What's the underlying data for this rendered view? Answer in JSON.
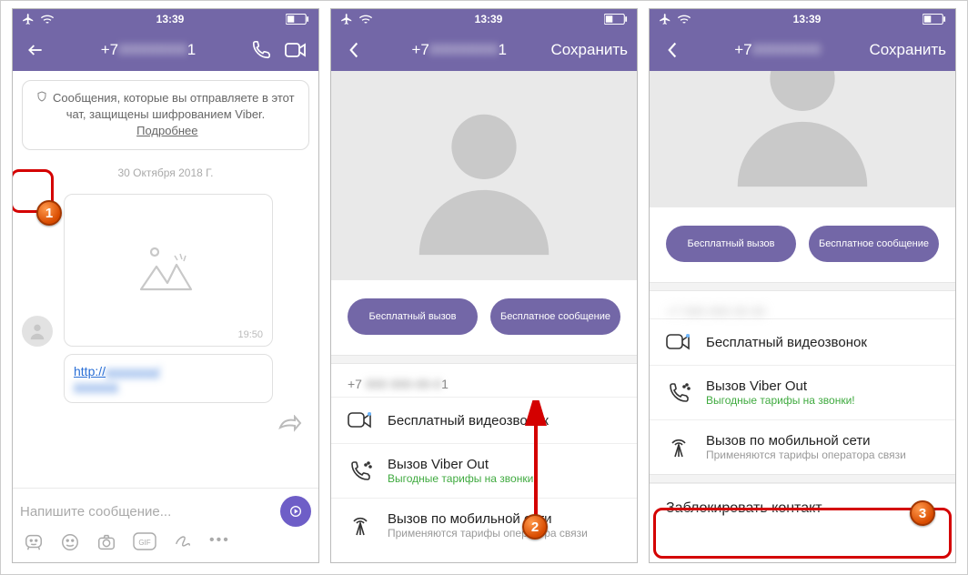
{
  "status": {
    "time": "13:39"
  },
  "screen1": {
    "title_prefix": "+7",
    "title_suffix": "1",
    "encryption_notice": "Сообщения, которые вы отправляете в этот чат, защищены шифрованием Viber.",
    "encryption_more": "Подробнее",
    "date": "30 Октября 2018 Г.",
    "msg_time": "19:50",
    "link_prefix": "http://",
    "compose_placeholder": "Напишите сообщение..."
  },
  "screen2": {
    "title_prefix": "+7",
    "title_suffix": "1",
    "save": "Сохранить",
    "cta_call": "Бесплатный вызов",
    "cta_msg": "Бесплатное сообщение",
    "phone_prefix": "+7",
    "phone_suffix": "1",
    "opt_video": "Бесплатный видеозвонок",
    "opt_viberout": "Вызов Viber Out",
    "opt_viberout_sub": "Выгодные тарифы на звонки!",
    "opt_mobile": "Вызов по мобильной сети",
    "opt_mobile_sub": "Применяются тарифы оператора связи"
  },
  "screen3": {
    "title_prefix": "+7",
    "save": "Сохранить",
    "cta_call": "Бесплатный вызов",
    "cta_msg": "Бесплатное сообщение",
    "opt_video": "Бесплатный видеозвонок",
    "opt_viberout": "Вызов Viber Out",
    "opt_viberout_sub": "Выгодные тарифы на звонки!",
    "opt_mobile": "Вызов по мобильной сети",
    "opt_mobile_sub": "Применяются тарифы оператора связи",
    "block": "Заблокировать контакт"
  },
  "badges": {
    "b1": "1",
    "b2": "2",
    "b3": "3"
  }
}
